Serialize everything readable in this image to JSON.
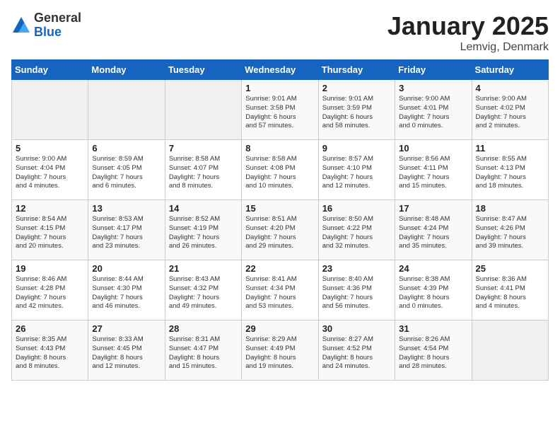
{
  "header": {
    "logo_general": "General",
    "logo_blue": "Blue",
    "title": "January 2025",
    "subtitle": "Lemvig, Denmark"
  },
  "weekdays": [
    "Sunday",
    "Monday",
    "Tuesday",
    "Wednesday",
    "Thursday",
    "Friday",
    "Saturday"
  ],
  "weeks": [
    [
      {
        "day": "",
        "info": ""
      },
      {
        "day": "",
        "info": ""
      },
      {
        "day": "",
        "info": ""
      },
      {
        "day": "1",
        "info": "Sunrise: 9:01 AM\nSunset: 3:58 PM\nDaylight: 6 hours\nand 57 minutes."
      },
      {
        "day": "2",
        "info": "Sunrise: 9:01 AM\nSunset: 3:59 PM\nDaylight: 6 hours\nand 58 minutes."
      },
      {
        "day": "3",
        "info": "Sunrise: 9:00 AM\nSunset: 4:01 PM\nDaylight: 7 hours\nand 0 minutes."
      },
      {
        "day": "4",
        "info": "Sunrise: 9:00 AM\nSunset: 4:02 PM\nDaylight: 7 hours\nand 2 minutes."
      }
    ],
    [
      {
        "day": "5",
        "info": "Sunrise: 9:00 AM\nSunset: 4:04 PM\nDaylight: 7 hours\nand 4 minutes."
      },
      {
        "day": "6",
        "info": "Sunrise: 8:59 AM\nSunset: 4:05 PM\nDaylight: 7 hours\nand 6 minutes."
      },
      {
        "day": "7",
        "info": "Sunrise: 8:58 AM\nSunset: 4:07 PM\nDaylight: 7 hours\nand 8 minutes."
      },
      {
        "day": "8",
        "info": "Sunrise: 8:58 AM\nSunset: 4:08 PM\nDaylight: 7 hours\nand 10 minutes."
      },
      {
        "day": "9",
        "info": "Sunrise: 8:57 AM\nSunset: 4:10 PM\nDaylight: 7 hours\nand 12 minutes."
      },
      {
        "day": "10",
        "info": "Sunrise: 8:56 AM\nSunset: 4:11 PM\nDaylight: 7 hours\nand 15 minutes."
      },
      {
        "day": "11",
        "info": "Sunrise: 8:55 AM\nSunset: 4:13 PM\nDaylight: 7 hours\nand 18 minutes."
      }
    ],
    [
      {
        "day": "12",
        "info": "Sunrise: 8:54 AM\nSunset: 4:15 PM\nDaylight: 7 hours\nand 20 minutes."
      },
      {
        "day": "13",
        "info": "Sunrise: 8:53 AM\nSunset: 4:17 PM\nDaylight: 7 hours\nand 23 minutes."
      },
      {
        "day": "14",
        "info": "Sunrise: 8:52 AM\nSunset: 4:19 PM\nDaylight: 7 hours\nand 26 minutes."
      },
      {
        "day": "15",
        "info": "Sunrise: 8:51 AM\nSunset: 4:20 PM\nDaylight: 7 hours\nand 29 minutes."
      },
      {
        "day": "16",
        "info": "Sunrise: 8:50 AM\nSunset: 4:22 PM\nDaylight: 7 hours\nand 32 minutes."
      },
      {
        "day": "17",
        "info": "Sunrise: 8:48 AM\nSunset: 4:24 PM\nDaylight: 7 hours\nand 35 minutes."
      },
      {
        "day": "18",
        "info": "Sunrise: 8:47 AM\nSunset: 4:26 PM\nDaylight: 7 hours\nand 39 minutes."
      }
    ],
    [
      {
        "day": "19",
        "info": "Sunrise: 8:46 AM\nSunset: 4:28 PM\nDaylight: 7 hours\nand 42 minutes."
      },
      {
        "day": "20",
        "info": "Sunrise: 8:44 AM\nSunset: 4:30 PM\nDaylight: 7 hours\nand 46 minutes."
      },
      {
        "day": "21",
        "info": "Sunrise: 8:43 AM\nSunset: 4:32 PM\nDaylight: 7 hours\nand 49 minutes."
      },
      {
        "day": "22",
        "info": "Sunrise: 8:41 AM\nSunset: 4:34 PM\nDaylight: 7 hours\nand 53 minutes."
      },
      {
        "day": "23",
        "info": "Sunrise: 8:40 AM\nSunset: 4:36 PM\nDaylight: 7 hours\nand 56 minutes."
      },
      {
        "day": "24",
        "info": "Sunrise: 8:38 AM\nSunset: 4:39 PM\nDaylight: 8 hours\nand 0 minutes."
      },
      {
        "day": "25",
        "info": "Sunrise: 8:36 AM\nSunset: 4:41 PM\nDaylight: 8 hours\nand 4 minutes."
      }
    ],
    [
      {
        "day": "26",
        "info": "Sunrise: 8:35 AM\nSunset: 4:43 PM\nDaylight: 8 hours\nand 8 minutes."
      },
      {
        "day": "27",
        "info": "Sunrise: 8:33 AM\nSunset: 4:45 PM\nDaylight: 8 hours\nand 12 minutes."
      },
      {
        "day": "28",
        "info": "Sunrise: 8:31 AM\nSunset: 4:47 PM\nDaylight: 8 hours\nand 15 minutes."
      },
      {
        "day": "29",
        "info": "Sunrise: 8:29 AM\nSunset: 4:49 PM\nDaylight: 8 hours\nand 19 minutes."
      },
      {
        "day": "30",
        "info": "Sunrise: 8:27 AM\nSunset: 4:52 PM\nDaylight: 8 hours\nand 24 minutes."
      },
      {
        "day": "31",
        "info": "Sunrise: 8:26 AM\nSunset: 4:54 PM\nDaylight: 8 hours\nand 28 minutes."
      },
      {
        "day": "",
        "info": ""
      }
    ]
  ]
}
